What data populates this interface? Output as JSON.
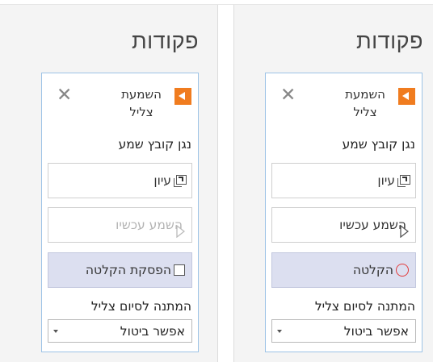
{
  "panes": [
    {
      "id": "left",
      "title": "פקודות",
      "card_title": "השמעת צליל",
      "close_glyph": "✕",
      "section_label": "נגן קובץ שמע",
      "edit_label": "עיון",
      "play_label": "השמע עכשיו",
      "play_disabled": true,
      "record_label": "הפסקת הקלטה",
      "record_icon": "stop-square-icon",
      "wait_label": "המתנה לסיום צליל",
      "select_value": "אפשר ביטול"
    },
    {
      "id": "right",
      "title": "פקודות",
      "card_title": "השמעת צליל",
      "close_glyph": "✕",
      "section_label": "נגן קובץ שמע",
      "edit_label": "עיון",
      "play_label": "השמע עכשיו",
      "play_disabled": false,
      "record_label": "הקלטה",
      "record_icon": "record-circle-icon",
      "wait_label": "המתנה לסיום צליל",
      "select_value": "אפשר ביטול"
    }
  ],
  "colors": {
    "accent_orange": "#f07c1f",
    "card_border": "#9dc3e6",
    "record_bg": "#dcdff0",
    "record_red": "#e23b3b",
    "pane_bg": "#f4f4f4"
  }
}
